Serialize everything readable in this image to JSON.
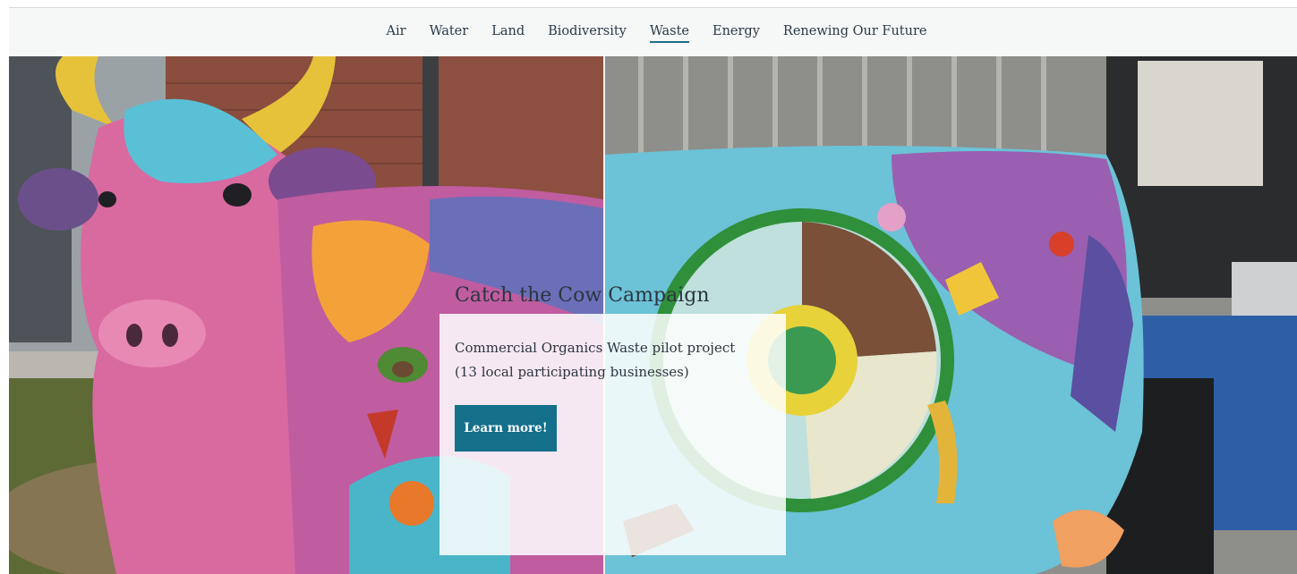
{
  "nav": {
    "items": [
      {
        "label": "Air"
      },
      {
        "label": "Water"
      },
      {
        "label": "Land"
      },
      {
        "label": "Biodiversity"
      },
      {
        "label": "Waste",
        "active": true
      },
      {
        "label": "Energy"
      },
      {
        "label": "Renewing Our Future"
      }
    ]
  },
  "hero": {
    "title": "Catch the Cow Campaign",
    "description_lines": [
      "Commercial Organics Waste pilot project",
      "(13 local participating businesses)"
    ],
    "button_label": "Learn more!"
  },
  "colors": {
    "accent": "#136f8a",
    "nav_background": "#f6f7f7",
    "text": "#2b3540"
  }
}
